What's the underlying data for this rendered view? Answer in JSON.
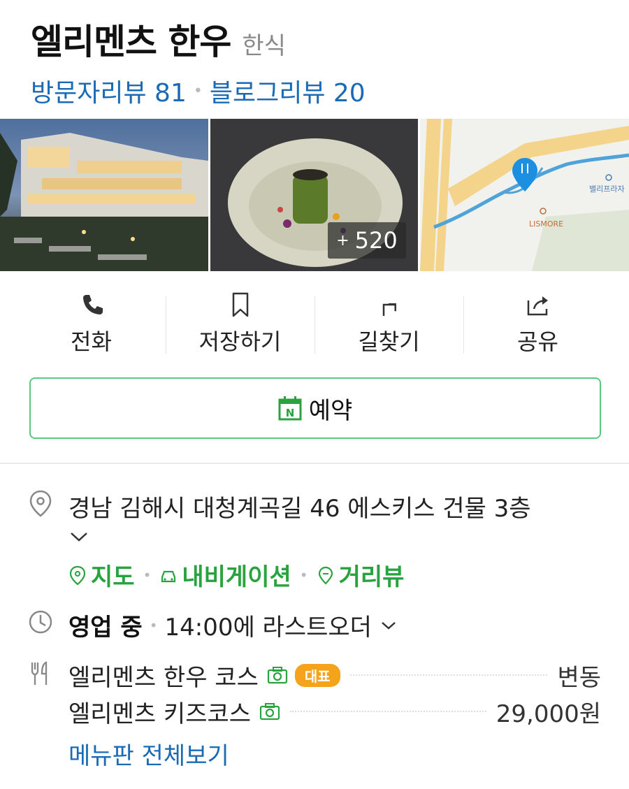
{
  "header": {
    "title": "엘리멘츠 한우",
    "category": "한식",
    "visitor_reviews": "방문자리뷰 81",
    "blog_reviews": "블로그리뷰 20"
  },
  "photos": {
    "more_count": "520",
    "more_prefix": "+",
    "map_labels": [
      "밸리프라자",
      "LISMORE"
    ]
  },
  "actions": [
    {
      "label": "전화",
      "icon": "phone-icon"
    },
    {
      "label": "저장하기",
      "icon": "bookmark-icon"
    },
    {
      "label": "길찾기",
      "icon": "directions-icon"
    },
    {
      "label": "공유",
      "icon": "share-icon"
    }
  ],
  "reserve": {
    "label": "예약",
    "icon": "naver-booking-icon"
  },
  "address": {
    "text": "경남 김해시 대청계곡길 46 에스키스 건물 3층"
  },
  "links": [
    {
      "label": "지도",
      "icon": "map-pin-icon"
    },
    {
      "label": "내비게이션",
      "icon": "car-icon"
    },
    {
      "label": "거리뷰",
      "icon": "street-view-icon"
    }
  ],
  "hours": {
    "status": "영업 중",
    "detail": "14:00에 라스트오더"
  },
  "menu": {
    "items": [
      {
        "name": "엘리멘츠 한우 코스",
        "badge": "대표",
        "price": "변동"
      },
      {
        "name": "엘리멘츠 키즈코스",
        "badge": "",
        "price": "29,000원"
      }
    ],
    "view_all": "메뉴판 전체보기"
  },
  "colors": {
    "accent_blue": "#1a6ab5",
    "naver_green": "#29a33f",
    "badge_orange": "#f5a31a"
  }
}
